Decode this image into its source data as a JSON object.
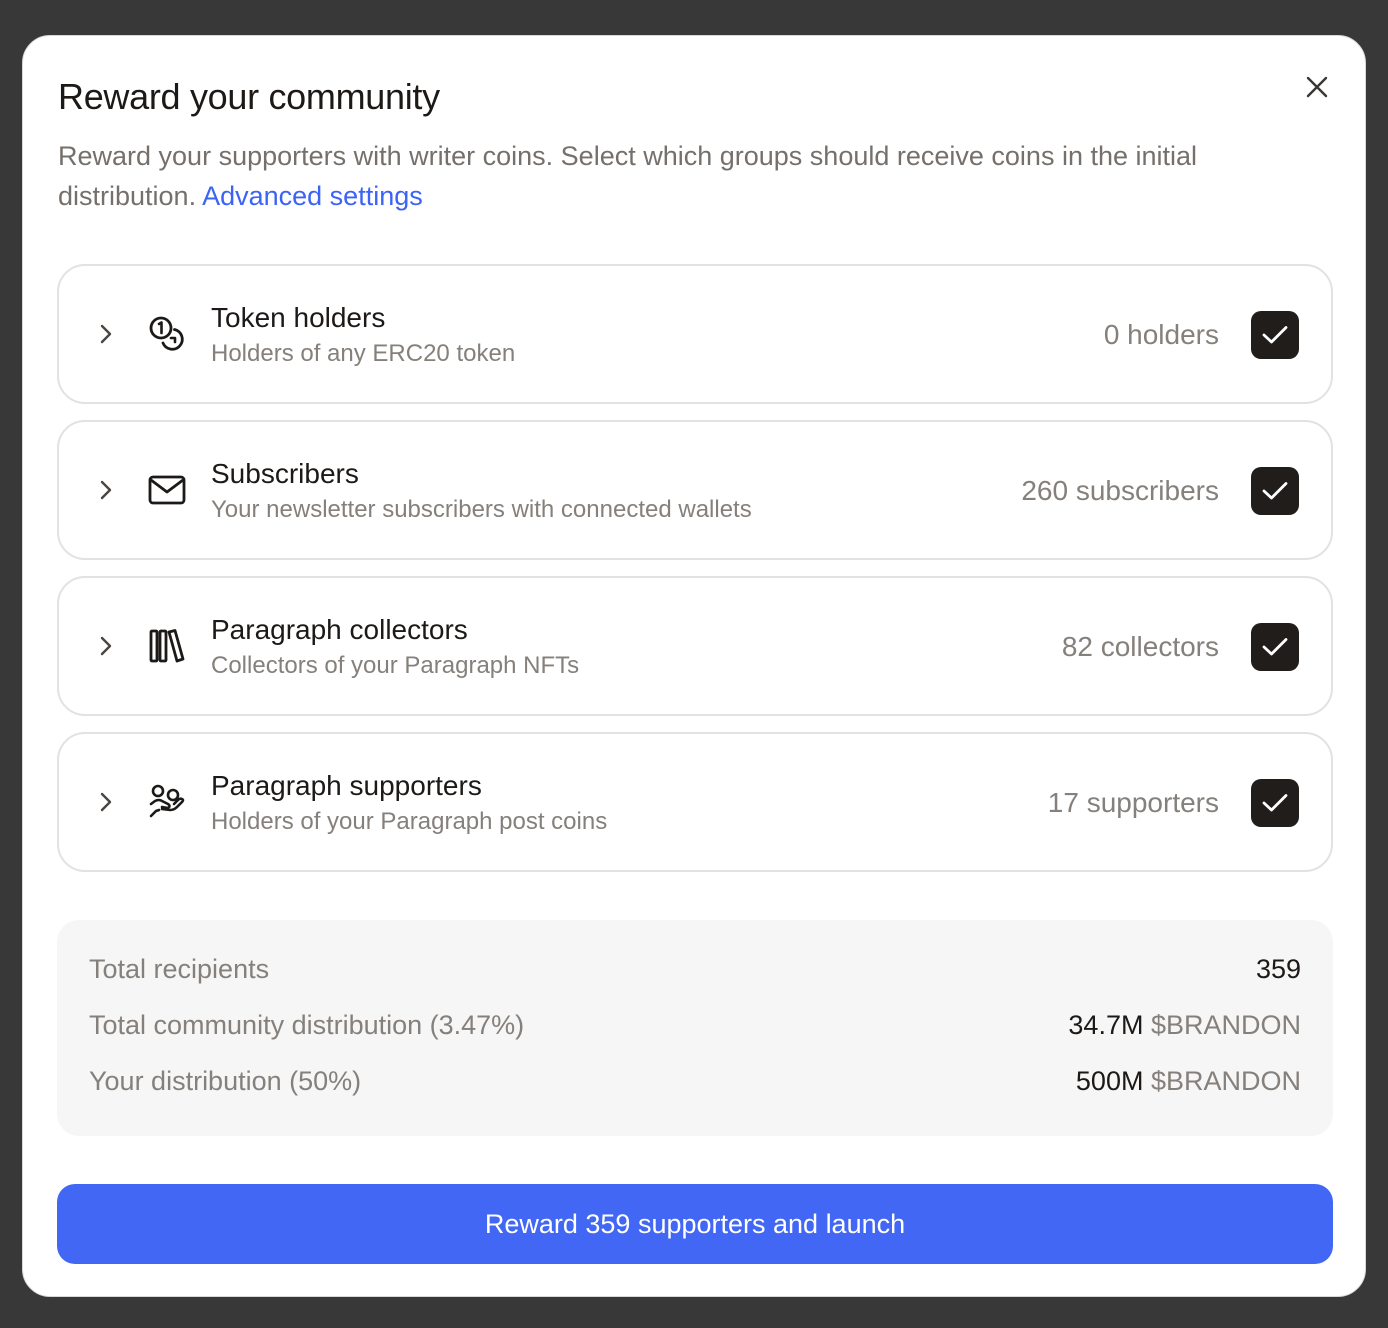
{
  "modal": {
    "title": "Reward your community",
    "description": "Reward your supporters with writer coins. Select which groups should receive coins in the initial distribution.",
    "advanced_link": "Advanced settings"
  },
  "groups": [
    {
      "icon": "coins-icon",
      "title": "Token holders",
      "subtitle": "Holders of any ERC20 token",
      "count": "0 holders",
      "checked": true
    },
    {
      "icon": "mail-icon",
      "title": "Subscribers",
      "subtitle": "Your newsletter subscribers with connected wallets",
      "count": "260 subscribers",
      "checked": true
    },
    {
      "icon": "library-icon",
      "title": "Paragraph collectors",
      "subtitle": "Collectors of your Paragraph NFTs",
      "count": "82 collectors",
      "checked": true
    },
    {
      "icon": "hand-coins-icon",
      "title": "Paragraph supporters",
      "subtitle": "Holders of your Paragraph post coins",
      "count": "17 supporters",
      "checked": true
    }
  ],
  "summary": {
    "total_recipients_label": "Total recipients",
    "total_recipients_value": "359",
    "community_label": "Total community distribution (3.47%)",
    "community_value": "34.7M",
    "community_unit": "$BRANDON",
    "your_label": "Your distribution (50%)",
    "your_value": "500M",
    "your_unit": "$BRANDON"
  },
  "cta": {
    "label": "Reward 359 supporters and launch"
  },
  "colors": {
    "accent": "#4267f5",
    "link": "#3b63f5",
    "checkbox": "#211d1b"
  }
}
